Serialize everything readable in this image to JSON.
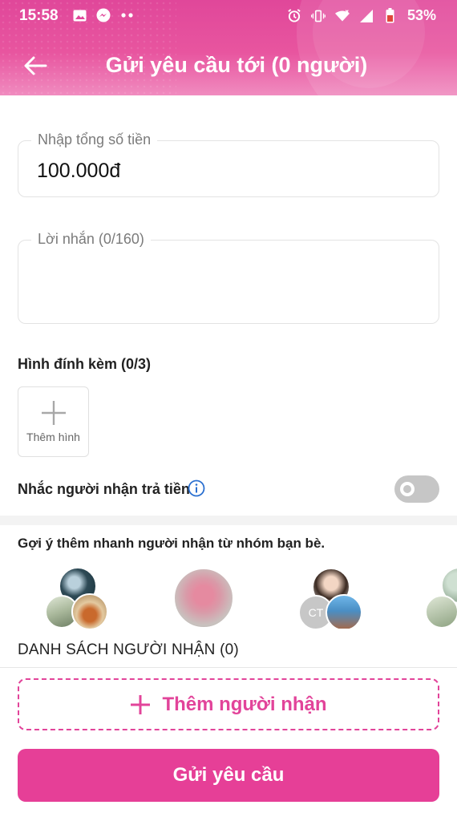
{
  "status_bar": {
    "time": "15:58",
    "battery": "53%",
    "icons_left": [
      "gallery-icon",
      "messenger-icon",
      "more-dots-icon"
    ],
    "icons_right": [
      "alarm-icon",
      "vibrate-icon",
      "wifi-icon",
      "signal-icon",
      "battery-icon"
    ]
  },
  "header": {
    "title": "Gửi yêu cầu tới (0 người)",
    "back_icon": "arrow-left-icon"
  },
  "form": {
    "amount_label": "Nhập tổng số tiền",
    "amount_value": "100.000đ",
    "message_label": "Lời nhắn (0/160)",
    "message_value": ""
  },
  "attachments": {
    "title": "Hình đính kèm (0/3)",
    "add_label": "Thêm hình"
  },
  "reminder": {
    "label": "Nhắc người nhận trả tiền",
    "enabled": false
  },
  "suggestions": {
    "title": "Gợi ý thêm nhanh người nhận từ nhóm bạn bè.",
    "avatar_initials": "CT"
  },
  "recipients": {
    "title": "DANH SÁCH NGƯỜI NHẬN (0)",
    "add_label": "Thêm người nhận"
  },
  "submit_label": "Gửi yêu cầu",
  "colors": {
    "accent": "#e63f97",
    "header_start": "#e0479a",
    "header_end": "#f08bbf"
  }
}
